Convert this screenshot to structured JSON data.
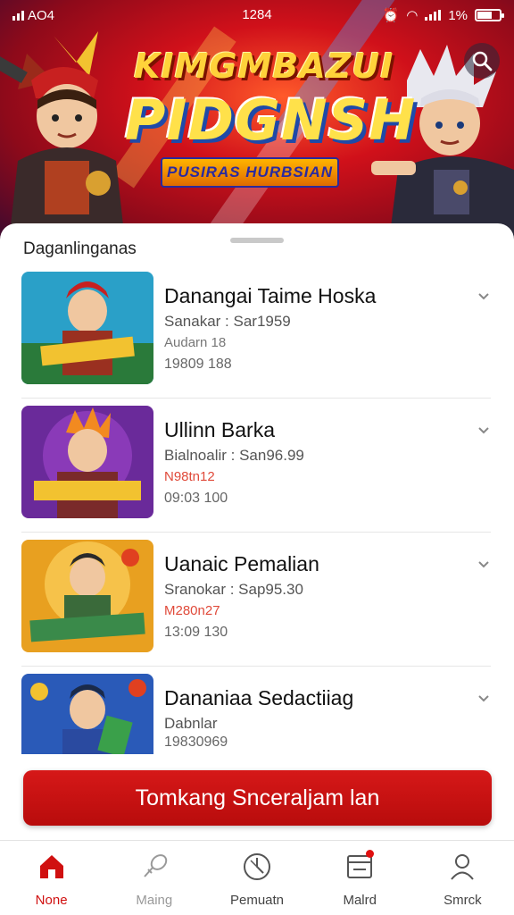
{
  "status_bar": {
    "left": "AO4",
    "time": "1284",
    "battery": "1%"
  },
  "banner": {
    "title_line1": "KIMGMBAZUI",
    "title_line2": "PIDGNSH",
    "subtitle": "PUSIRAS HURBSIAN",
    "colors": {
      "primary": "#d0101a",
      "title": "#ffd23a"
    }
  },
  "section": {
    "title": "Daganlinganas"
  },
  "items": [
    {
      "title": "Danangai Taime Hoska",
      "line1": "Sanakar : Sar1959",
      "line2": "Audarn 18",
      "line3": "19809 188",
      "line2_red": false
    },
    {
      "title": "Ullinn Barka",
      "line1": "Bialnoalir : San96.99",
      "line2": "N98tn12",
      "line3": "09:03 100",
      "line2_red": true
    },
    {
      "title": "Uanaic Pemalian",
      "line1": "Sranokar : Sap95.30",
      "line2": "M280n27",
      "line3": "13:09 130",
      "line2_red": true
    },
    {
      "title": "Dananiaa Sedactiiag",
      "line1": "Dabnlar",
      "line2": "",
      "line3": "19830969",
      "line2_red": false
    }
  ],
  "cta": {
    "label": "Tomkang Snceraljam lan",
    "color": "#c81212"
  },
  "nav": [
    {
      "label": "None",
      "icon": "home-icon",
      "state": "active"
    },
    {
      "label": "Maing",
      "icon": "rocket-icon",
      "state": "muted"
    },
    {
      "label": "Pemuatn",
      "icon": "compass-icon",
      "state": "normal"
    },
    {
      "label": "Malrd",
      "icon": "window-icon",
      "state": "normal",
      "badge": true
    },
    {
      "label": "Smrck",
      "icon": "person-icon",
      "state": "normal"
    }
  ]
}
